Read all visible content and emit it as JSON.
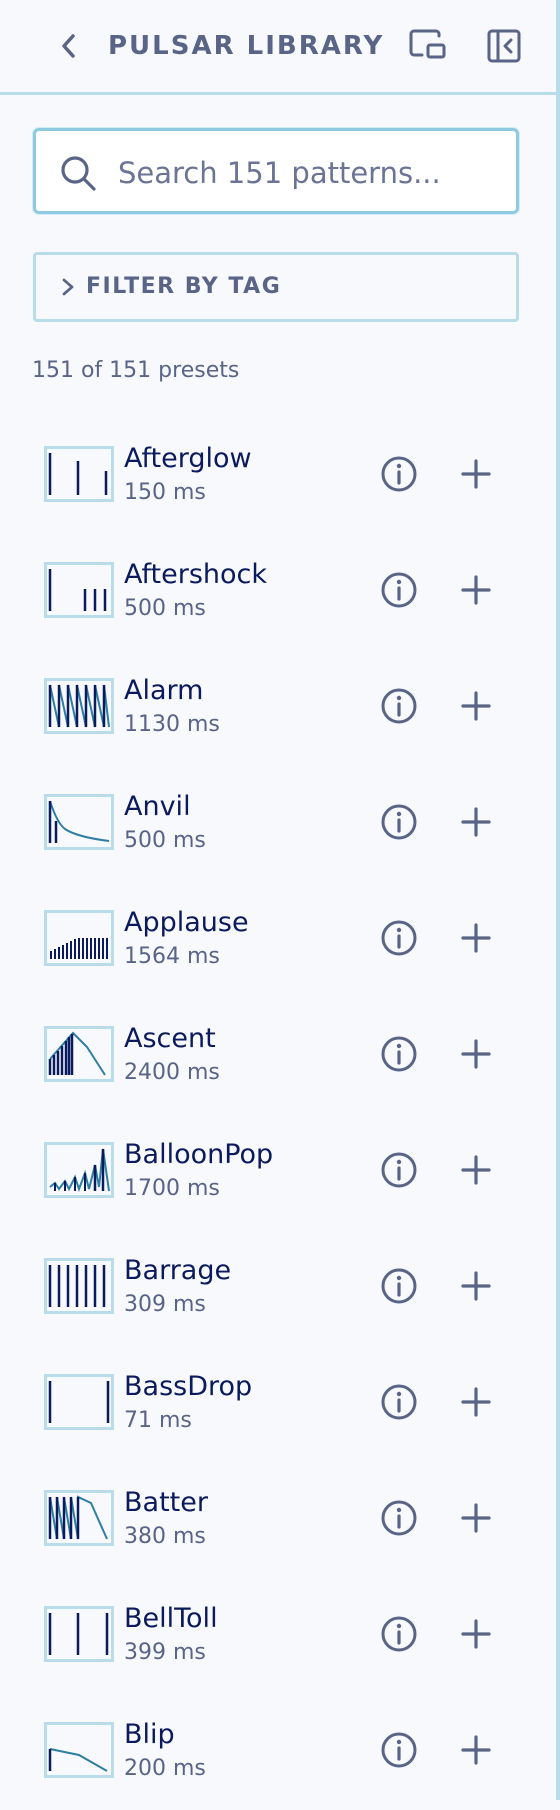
{
  "header": {
    "title": "PULSAR LIBRARY",
    "icons": [
      "chevron-left-icon",
      "picture-in-picture-icon",
      "collapse-panel-icon"
    ]
  },
  "search": {
    "placeholder": "Search 151 patterns...",
    "value": ""
  },
  "filter": {
    "label": "FILTER BY TAG",
    "icon": "chevron-right-icon"
  },
  "count_text": "151 of 151 presets",
  "colors": {
    "accent_border": "#8ecbe0",
    "panel_border": "#b9dcea",
    "name_text": "#0b1a5c",
    "muted_text": "#5a6486",
    "waveform_bar": "#0b1a5c",
    "waveform_curve": "#2e7ea3"
  },
  "presets": [
    {
      "name": "Afterglow",
      "duration": "150 ms"
    },
    {
      "name": "Aftershock",
      "duration": "500 ms"
    },
    {
      "name": "Alarm",
      "duration": "1130 ms"
    },
    {
      "name": "Anvil",
      "duration": "500 ms"
    },
    {
      "name": "Applause",
      "duration": "1564 ms"
    },
    {
      "name": "Ascent",
      "duration": "2400 ms"
    },
    {
      "name": "BalloonPop",
      "duration": "1700 ms"
    },
    {
      "name": "Barrage",
      "duration": "309 ms"
    },
    {
      "name": "BassDrop",
      "duration": "71 ms"
    },
    {
      "name": "Batter",
      "duration": "380 ms"
    },
    {
      "name": "BellToll",
      "duration": "399 ms"
    },
    {
      "name": "Blip",
      "duration": "200 ms"
    }
  ]
}
